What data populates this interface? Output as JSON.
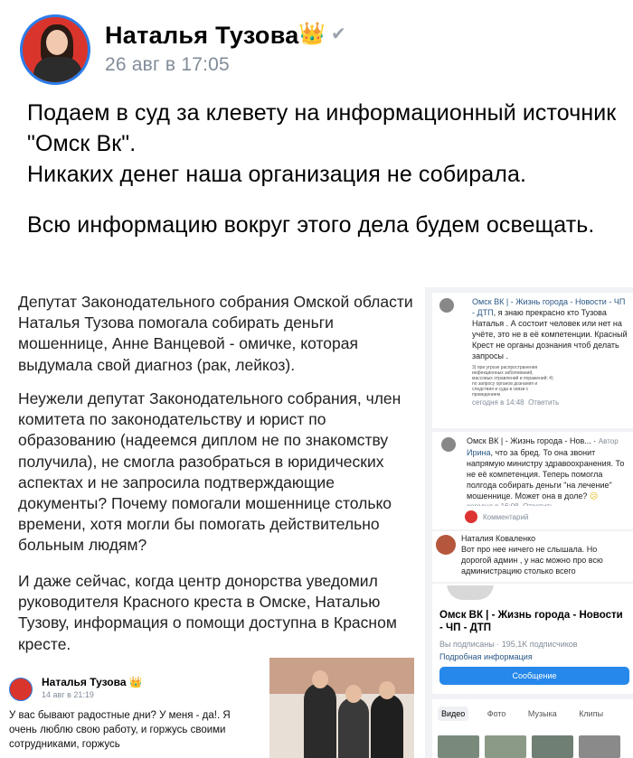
{
  "post": {
    "author": "Наталья Тузова",
    "crown_icon": "crown-icon",
    "verified_icon": "verified-checkmark-icon",
    "time": "26 авг в 17:05",
    "paragraphs": [
      "Подаем в суд за клевету на информационный источник \"Омск Вк\".",
      "Никаких денег наша организация не собирала.",
      "Всю информацию вокруг этого дела будем освещать."
    ]
  },
  "attachment": {
    "left_text": {
      "p1": "Депутат Законодательного собрания Омской области Наталья Тузова помогала собирать деньги мошеннице, Анне Ванцевой - омичке, которая выдумала свой диагноз (рак, лейкоз).",
      "p2": "Неужели депутат Законодательного собрания, член комитета по законодательству и юрист по образованию (надеемся диплом не по знакомству получила), не смогла разобраться в юридических аспектах и не запросила подтверждающие документы?  Почему помогали мошеннице столько времени, хотя могли бы помогать действительно больным людям?",
      "p3": "И даже сейчас, когда центр донорства уведомил руководителя Красного креста в Омске, Наталью Тузову, информация о помощи доступна в Красном кресте."
    },
    "comments": {
      "c1_author": "Омск ВК | - Жизнь города - Новости - ЧП - ДТП",
      "c1_text": ", я знаю прекрасно кто Тузова Наталья . А состоит человек или нет на учёте,  это не в её компетенции. Красный Крест не органы дознания чтоб делать запросы .",
      "c1_doc": "3) при угрозе распространения инфекционных заболеваний, массовых отравлений и поражений; 4) по запросу органов дознания и следствия и суда в связи с проведением",
      "c1_time": "сегодня в 14:48",
      "c1_reply": "Ответить",
      "c2_author": "Омск ВК | - Жизнь города - Нов...",
      "c2_badge": "Автор",
      "c2_mention": "Ирина",
      "c2_text": ", что за бред. То она звонит напрямую министру здравоохранения. То не её компетенция. Теперь помогла полгода собирать деньги \"на лечение\" мошеннице. Может она в доле?",
      "c2_emoji": "😕",
      "c2_time": "сегодня в 16:08",
      "c2_reply": "Ответить",
      "comment_placeholder": "Комментарий",
      "c3_author": "Наталия Коваленко",
      "c3_text": "Вот про нее ничего не слышала. Но дорогой админ , у нас можно про всю администрацию столько всего"
    },
    "group": {
      "name": "Омск ВК | - Жизнь города - Новости - ЧП - ДТП",
      "subscribed": "Вы подписаны · 195,1K подписчиков",
      "more_info": "Подробная информация",
      "message_button": "Сообщение"
    },
    "tabs": [
      "Видео",
      "Фото",
      "Музыка",
      "Клипы"
    ],
    "bottom_post": {
      "author": "Наталья Тузова",
      "time": "14 авг в 21:19",
      "text": "У вас бывают радостные дни? У меня - да!. Я очень люблю свою работу, и горжусь  своими сотрудниками, горжусь"
    }
  }
}
